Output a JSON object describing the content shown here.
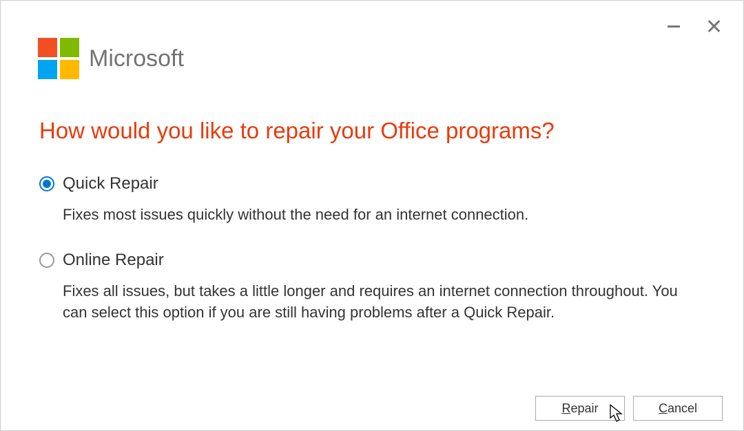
{
  "brand": "Microsoft",
  "title": "How would you like to repair your Office programs?",
  "options": [
    {
      "label": "Quick Repair",
      "desc": "Fixes most issues quickly without the need for an internet connection.",
      "selected": true
    },
    {
      "label": "Online Repair",
      "desc": "Fixes all issues, but takes a little longer and requires an internet connection throughout. You can select this option if you are still having problems after a Quick Repair.",
      "selected": false
    }
  ],
  "buttons": {
    "repair": "Repair",
    "cancel": "Cancel"
  }
}
